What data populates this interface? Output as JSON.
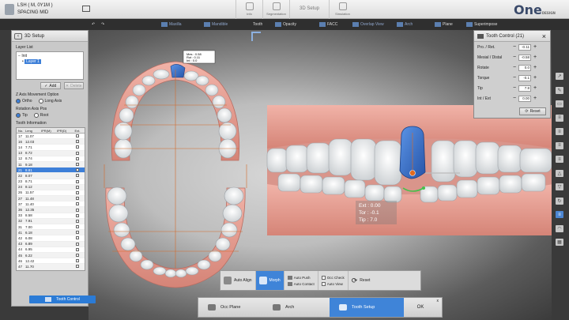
{
  "patient": {
    "name": "LSH ( M, 0Y1M )",
    "case": "SPACING MID"
  },
  "tabs": [
    {
      "label": "Info"
    },
    {
      "label": "Segmentation"
    },
    {
      "label": "3D Setup"
    },
    {
      "label": "Simulation"
    }
  ],
  "logo": {
    "main": "One",
    "sub": "DESIGN"
  },
  "toolbar": {
    "items": [
      "Maxilla",
      "Mandible",
      "Tooth",
      "Opacity",
      "FACC",
      "Overlap View",
      "Arch",
      "Plane",
      "Superimpose"
    ]
  },
  "left_panel": {
    "title": "3D Setup",
    "layer_list_label": "Layer List",
    "layers": [
      "Init",
      "Layer 1"
    ],
    "add_label": "Add",
    "delete_label": "Delete",
    "z_axis_label": "Z Axis Movement Option",
    "z_axis_options": [
      "Ortho",
      "Long Axis"
    ],
    "rotation_label": "Rotation Axis Pos",
    "rotation_options": [
      "Tip",
      "Root"
    ],
    "tooth_info_label": "Tooth Information",
    "tooth_columns": [
      "No.",
      "Leng",
      "IPR(M)",
      "IPR(D)",
      "Ext."
    ],
    "tooth_rows": [
      [
        "17",
        "11.07"
      ],
      [
        "16",
        "12.03"
      ],
      [
        "14",
        "7.71"
      ],
      [
        "13",
        "8.72"
      ],
      [
        "12",
        "8.74"
      ],
      [
        "11",
        "9.18"
      ],
      [
        "21",
        "8.81"
      ],
      [
        "22",
        "8.07"
      ],
      [
        "23",
        "8.71"
      ],
      [
        "24",
        "8.12"
      ],
      [
        "26",
        "11.57"
      ],
      [
        "27",
        "11.48"
      ],
      [
        "37",
        "11.40"
      ],
      [
        "36",
        "12.35"
      ],
      [
        "33",
        "8.58"
      ],
      [
        "32",
        "7.91"
      ],
      [
        "31",
        "7.00"
      ],
      [
        "41",
        "6.18"
      ],
      [
        "42",
        "6.08"
      ],
      [
        "43",
        "6.89"
      ],
      [
        "44",
        "6.95"
      ],
      [
        "45",
        "6.22"
      ],
      [
        "46",
        "12.42"
      ],
      [
        "47",
        "11.70"
      ]
    ],
    "selected_row": 6,
    "tooth_control_label": "Tooth Control"
  },
  "tooth_control": {
    "title": "Tooth Control (21)",
    "rows": [
      {
        "label": "Pro. / Ret.",
        "value": "-0.11"
      },
      {
        "label": "Mesial / Distal",
        "value": "-0.58"
      },
      {
        "label": "Rotate",
        "value": "0.0"
      },
      {
        "label": "Torque",
        "value": "-0.1"
      },
      {
        "label": "Tip",
        "value": "7.8"
      },
      {
        "label": "Int / Ext",
        "value": "0.00"
      }
    ],
    "reset_label": "Reset"
  },
  "viewport": {
    "occlusal_readout": [
      "Mes : 0.58",
      "Rot : 0.11",
      "Int : 0.0"
    ],
    "frontal_readout": [
      "Ext :  0.00",
      "Tor :  -0.1",
      "Tip :   7.0"
    ]
  },
  "action_bar": {
    "auto_align": "Auto Align",
    "morph": "Morph",
    "auto_push": "Auto Push",
    "auto_contact": "Auto Contact",
    "occ_check": "Occ Check",
    "auto_view": "Auto View",
    "reset": "Reset"
  },
  "workflow": {
    "steps": [
      "Occ Plane",
      "Arch",
      "Tooth Setup"
    ],
    "ok": "OK",
    "close": "x"
  },
  "colors": {
    "accent": "#3f84d8",
    "gum": "#e8a49a",
    "selected_tooth": "#2f6fd0"
  }
}
